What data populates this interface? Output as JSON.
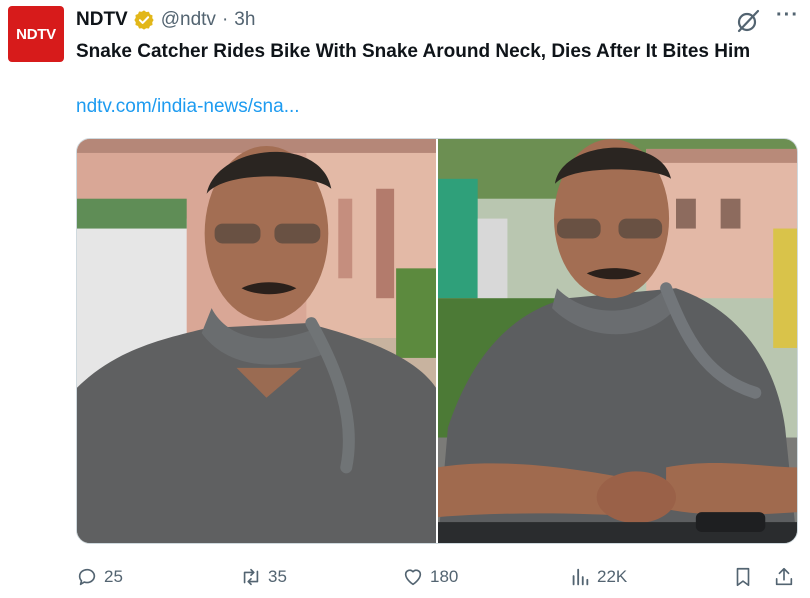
{
  "account": {
    "logo_text": "NDTV",
    "name": "NDTV",
    "handle": "@ndtv",
    "separator": "·",
    "time": "3h",
    "brand_color": "#d71b1b",
    "badge_color": "#e2b719"
  },
  "tweet": {
    "text": "Snake Catcher Rides Bike With Snake Around Neck, Dies After It Bites Him",
    "link": "ndtv.com/india-news/sna..."
  },
  "actions": {
    "replies": "25",
    "reposts": "35",
    "likes": "180",
    "views": "22K"
  },
  "icons": {
    "grok": "grok-icon",
    "more": "more-icon",
    "reply": "reply-icon",
    "repost": "repost-icon",
    "like": "heart-icon",
    "views": "views-icon",
    "bookmark": "bookmark-icon",
    "share": "share-icon"
  },
  "colors": {
    "text": "#0f1419",
    "muted": "#536471",
    "link": "#1d9bf0"
  }
}
